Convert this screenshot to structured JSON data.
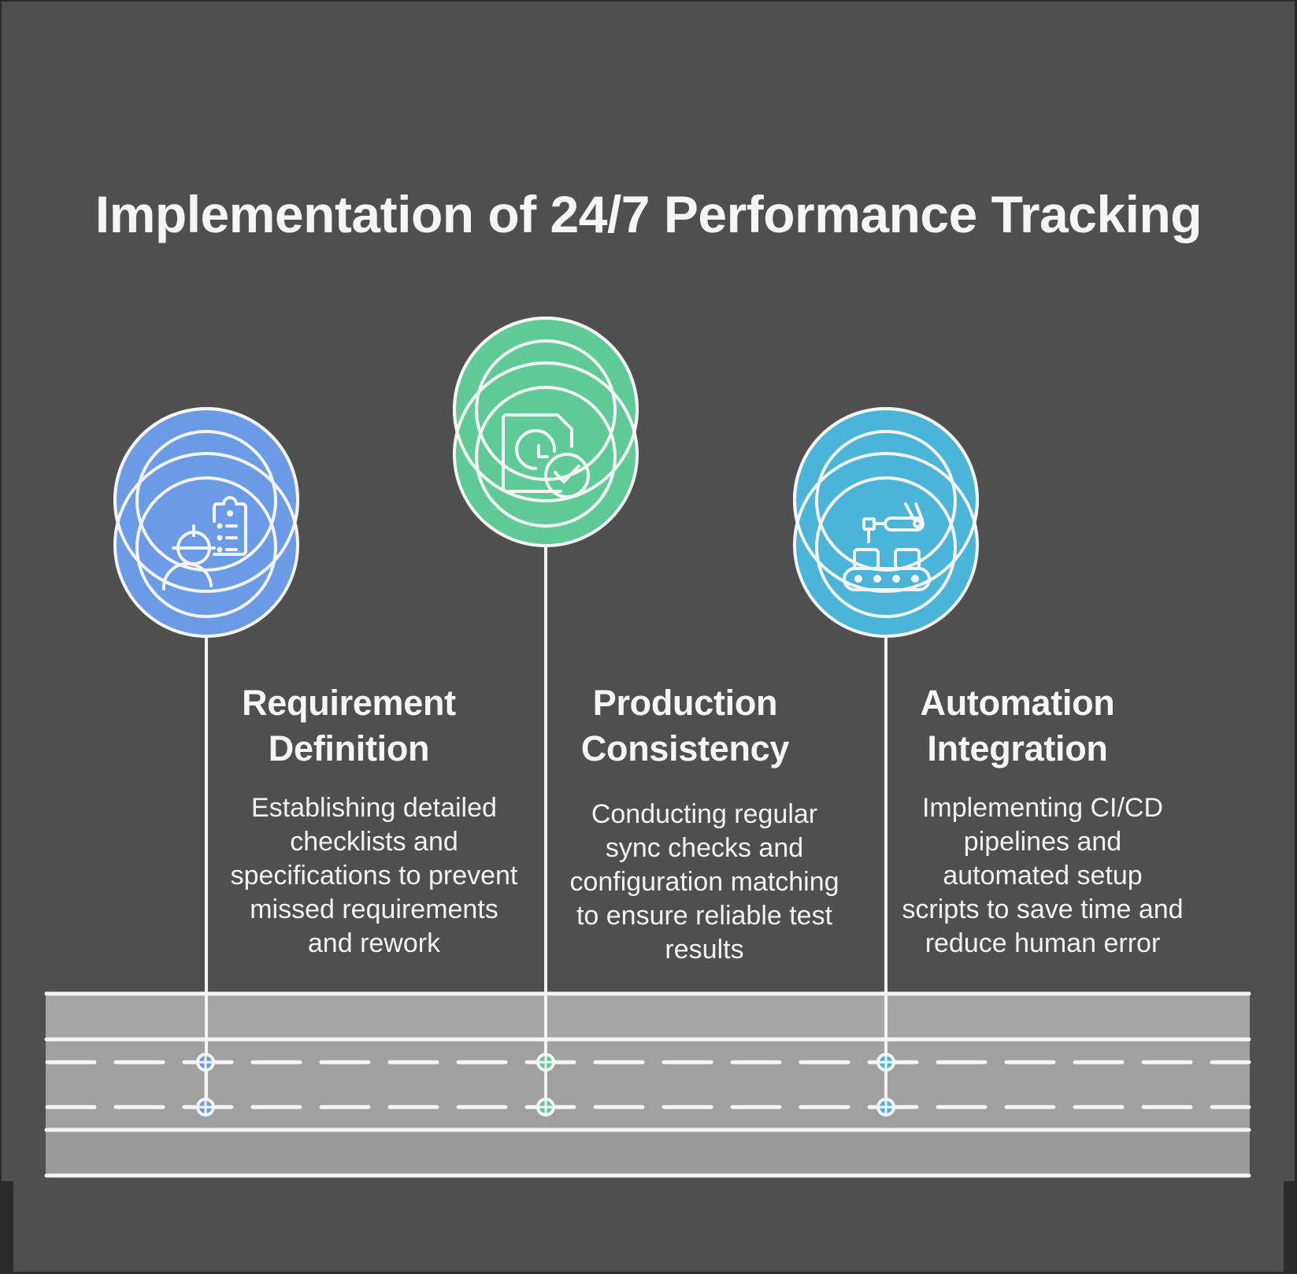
{
  "title": "Implementation of 24/7 Performance Tracking",
  "colors": {
    "background": "#4f4f4f",
    "frame": "#2b2b2b",
    "road": "#a0a0a0",
    "line": "#f4f4f4",
    "text": "#f5f5f5"
  },
  "steps": [
    {
      "title": "Requirement Definition",
      "description": "Establishing detailed checklists and specifications to prevent missed requirements and rework",
      "icon": "worker-checklist-icon",
      "color": "#6b9be6"
    },
    {
      "title": "Production Consistency",
      "description": "Conducting regular sync checks and configuration matching to ensure reliable test results",
      "icon": "document-clock-check-icon",
      "color": "#5ecb97"
    },
    {
      "title": "Automation Integration",
      "description": "Implementing CI/CD pipelines and automated setup scripts to save time and reduce human error",
      "icon": "robot-arm-conveyor-icon",
      "color": "#4ab4d9"
    }
  ]
}
